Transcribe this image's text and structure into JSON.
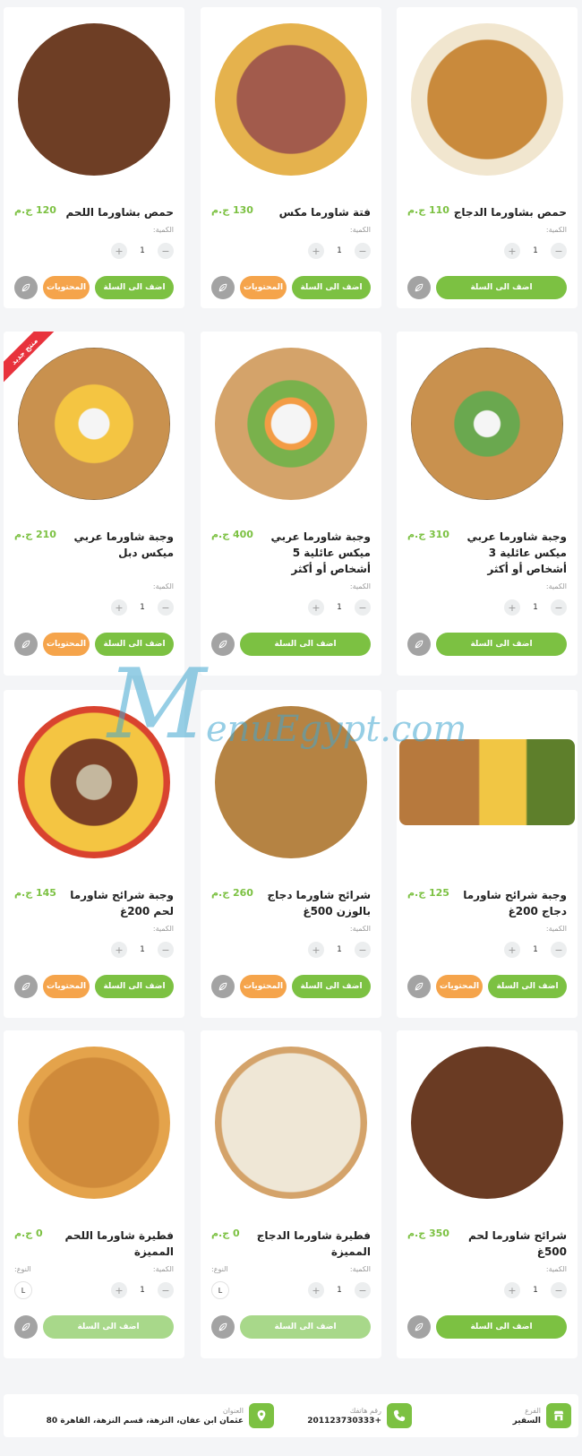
{
  "currency": "ج.م",
  "labels": {
    "quantity": "الكمية:",
    "type": "النوع:",
    "add_to_cart": "اضف الى السلة",
    "contents": "المحتويات",
    "new_badge": "منتج جديد"
  },
  "products": [
    {
      "name": "حمص بشاورما الدجاج",
      "price": "110 ج.م",
      "qty": "1",
      "has_contents": false,
      "type": null
    },
    {
      "name": "فتة شاورما مكس",
      "price": "130 ج.م",
      "qty": "1",
      "has_contents": true,
      "type": null
    },
    {
      "name": "حمص بشاورما اللحم",
      "price": "120 ج.م",
      "qty": "1",
      "has_contents": true,
      "type": null
    },
    {
      "name": "وجبة شاورما عربي ميكس عائلية 3 أشخاص أو أكثر",
      "price": "310 ج.م",
      "qty": "1",
      "has_contents": false,
      "type": null
    },
    {
      "name": "وجبة شاورما عربي ميكس عائلية 5 أشخاص أو أكثر",
      "price": "400 ج.م",
      "qty": "1",
      "has_contents": false,
      "type": null
    },
    {
      "name": "وجبة شاورما عربي ميكس دبل",
      "price": "210 ج.م",
      "qty": "1",
      "has_contents": true,
      "type": null,
      "is_new": true
    },
    {
      "name": "وجبة شرائح شاورما دجاج 200غ",
      "price": "125 ج.م",
      "qty": "1",
      "has_contents": true,
      "type": null
    },
    {
      "name": "شرائح شاورما دجاج بالوزن 500غ",
      "price": "260 ج.م",
      "qty": "1",
      "has_contents": true,
      "type": null
    },
    {
      "name": "وجبة شرائح شاورما لحم 200غ",
      "price": "145 ج.م",
      "qty": "1",
      "has_contents": true,
      "type": null
    },
    {
      "name": "شرائح شاورما لحم 500غ",
      "price": "350 ج.م",
      "qty": "1",
      "has_contents": false,
      "type": null
    },
    {
      "name": "فطيرة شاورما الدجاج المميزة",
      "price": "0 ج.م",
      "qty": "1",
      "has_contents": false,
      "type": "L"
    },
    {
      "name": "فطيرة شاورما اللحم المميزة",
      "price": "0 ج.م",
      "qty": "1",
      "has_contents": false,
      "type": "L"
    }
  ],
  "watermark": "MenuEgypt.com",
  "footer": {
    "branch": {
      "label": "الفرع",
      "value": "السفير"
    },
    "phone": {
      "label": "رقم هاتفك",
      "value": "+201123730333"
    },
    "address": {
      "label": "العنوان",
      "value": "عثمان ابن عفان، النزهة، قسم النزهة، القاهرة 80"
    }
  },
  "colors": {
    "accent": "#7cc142",
    "contents": "#f5a44b",
    "badge": "#e8323c",
    "fav": "#a3a3a3"
  }
}
